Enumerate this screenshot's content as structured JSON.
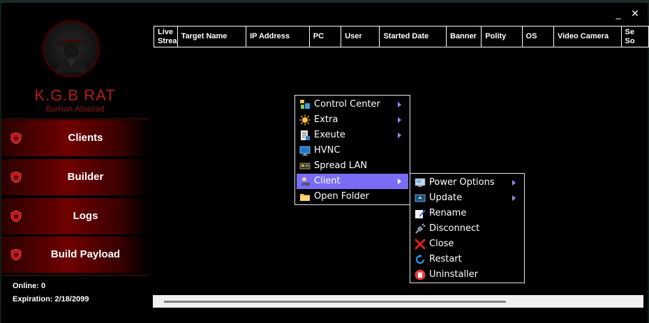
{
  "window": {
    "minimize_glyph": "_",
    "close_glyph": "✕"
  },
  "brand": {
    "title": "K.G.B RAT",
    "subtitle": "Burhan Alassad",
    "logo_icon": "spy-hat-logo-icon"
  },
  "sidebar": {
    "items": [
      {
        "label": "Clients",
        "icon": "shield-icon"
      },
      {
        "label": "Builder",
        "icon": "shield-icon"
      },
      {
        "label": "Logs",
        "icon": "shield-icon"
      },
      {
        "label": "Build Payload",
        "icon": "shield-icon"
      }
    ],
    "online_text": "Online: 0",
    "expiration_text": "Expiration: 2/18/2099"
  },
  "table": {
    "columns": [
      "Live Stream",
      "Target Name",
      "IP Address",
      "PC",
      "User",
      "Started Date",
      "Banner",
      "Polity",
      "OS",
      "Video Camera",
      "Se So"
    ]
  },
  "context_menu": {
    "items": [
      {
        "label": "Control Center",
        "icon": "control-center-icon",
        "submenu": true
      },
      {
        "label": "Extra",
        "icon": "sun-gear-icon",
        "submenu": true
      },
      {
        "label": "Exeute",
        "icon": "document-icon",
        "submenu": true
      },
      {
        "label": "HVNC",
        "icon": "monitor-icon",
        "submenu": false
      },
      {
        "label": "Spread LAN",
        "icon": "network-card-icon",
        "submenu": false
      },
      {
        "label": "Client",
        "icon": "user-desk-icon",
        "submenu": true,
        "active": true
      },
      {
        "label": "Open Folder",
        "icon": "folder-icon",
        "submenu": false
      }
    ]
  },
  "client_submenu": {
    "items": [
      {
        "label": "Power Options",
        "icon": "power-options-icon",
        "submenu": true
      },
      {
        "label": "Update",
        "icon": "update-icon",
        "submenu": true
      },
      {
        "label": "Rename",
        "icon": "rename-pencil-icon",
        "submenu": false
      },
      {
        "label": "Disconnect",
        "icon": "plug-icon",
        "submenu": false
      },
      {
        "label": "Close",
        "icon": "red-x-icon",
        "submenu": false
      },
      {
        "label": "Restart",
        "icon": "restart-icon",
        "submenu": false
      },
      {
        "label": "Uninstaller",
        "icon": "trash-icon",
        "submenu": false
      }
    ]
  },
  "colors": {
    "accent_red": "#b51b1b",
    "menu_highlight": "#7a6cf5",
    "background": "#000000"
  }
}
